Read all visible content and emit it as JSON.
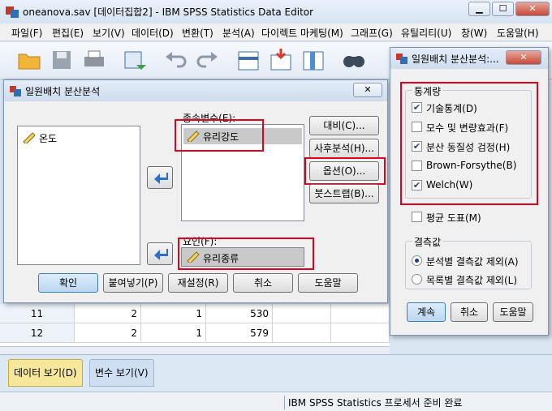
{
  "window": {
    "title": "oneanova.sav [데이터집합2] - IBM SPSS Statistics Data Editor",
    "min_label": "▁",
    "max_label": "☐",
    "close_label": "✕"
  },
  "menu": [
    "파일(F)",
    "편집(E)",
    "보기(V)",
    "데이터(D)",
    "변환(T)",
    "분석(A)",
    "다이렉트 마케팅(M)",
    "그래프(G)",
    "유틸리티(U)",
    "창(W)",
    "도움말(H)"
  ],
  "toolbar_icons": [
    "open-folder-icon",
    "save-icon",
    "print-icon",
    "dialog-recall-icon",
    "undo-icon",
    "redo-icon",
    "goto-case-icon",
    "insert-case-icon",
    "variables-icon",
    "find-icon"
  ],
  "grid": {
    "rows": [
      {
        "num": "11",
        "c1": "2",
        "c2": "1",
        "c3": "530"
      },
      {
        "num": "12",
        "c1": "2",
        "c2": "1",
        "c3": "579"
      }
    ]
  },
  "tabs": {
    "data_view": "데이터 보기(D)",
    "variable_view": "변수 보기(V)"
  },
  "status": "IBM SPSS Statistics 프로세서 준비 완료",
  "anova_dialog": {
    "title": "일원배치 분산분석",
    "close_label": "✕",
    "source_vars": [
      "온도"
    ],
    "dependent_label": "종속변수(E):",
    "dependent_vars": [
      "유리강도"
    ],
    "factor_label": "요인(F):",
    "factor_var": "유리종류",
    "buttons": {
      "contrasts": "대비(C)...",
      "post_hoc": "사후분석(H)...",
      "options": "옵션(O)...",
      "bootstrap": "붓스트랩(B)...",
      "ok": "확인",
      "paste": "붙여넣기(P)",
      "reset": "재설정(R)",
      "cancel": "취소",
      "help": "도움말"
    }
  },
  "options_dialog": {
    "title": "일원배치 분산분석:...",
    "close_label": "✕",
    "stats_group": "통계량",
    "checkboxes": [
      {
        "label": "기술통계(D)",
        "checked": true
      },
      {
        "label": "모수 및 변량효과(F)",
        "checked": false
      },
      {
        "label": "분산 동질성 검정(H)",
        "checked": true
      },
      {
        "label": "Brown-Forsythe(B)",
        "checked": false
      },
      {
        "label": "Welch(W)",
        "checked": true
      }
    ],
    "means_plot": {
      "label": "평균 도표(M)",
      "checked": false
    },
    "missing_group": "결측값",
    "radios": [
      {
        "label": "분석별 결측값 제외(A)",
        "selected": true
      },
      {
        "label": "목록별 결측값 제외(L)",
        "selected": false
      }
    ],
    "buttons": {
      "continue": "계속",
      "cancel": "취소",
      "help": "도움말"
    }
  }
}
